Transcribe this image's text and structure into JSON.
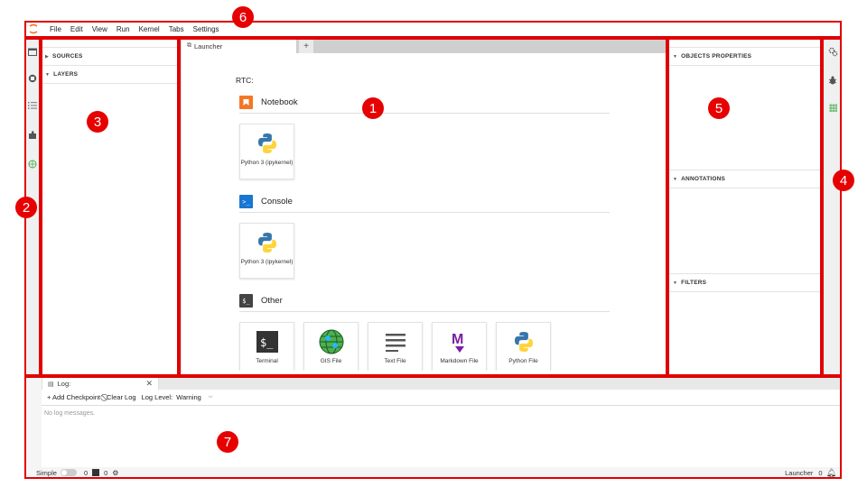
{
  "menubar": {
    "items": [
      "File",
      "Edit",
      "View",
      "Run",
      "Kernel",
      "Tabs",
      "Settings"
    ]
  },
  "left_panel": {
    "sections": [
      "SOURCES",
      "LAYERS"
    ]
  },
  "launcher": {
    "tab_label": "Launcher",
    "add_tab": "+",
    "rtc_label": "RTC:",
    "sections": [
      {
        "label": "Notebook",
        "icon": "notebook-icon",
        "cards": [
          {
            "label": "Python 3 (ipykernel)",
            "icon": "python-icon"
          }
        ]
      },
      {
        "label": "Console",
        "icon": "console-icon",
        "cards": [
          {
            "label": "Python 3 (ipykernel)",
            "icon": "python-icon"
          }
        ]
      },
      {
        "label": "Other",
        "icon": "other-icon",
        "cards": [
          {
            "label": "Terminal",
            "icon": "terminal-icon"
          },
          {
            "label": "GIS File",
            "icon": "globe-icon"
          },
          {
            "label": "Text File",
            "icon": "text-file-icon"
          },
          {
            "label": "Markdown File",
            "icon": "markdown-icon"
          },
          {
            "label": "Python File",
            "icon": "python-icon"
          }
        ]
      }
    ]
  },
  "right_panel": {
    "sections": [
      "OBJECTS PROPERTIES",
      "ANNOTATIONS",
      "FILTERS"
    ]
  },
  "log": {
    "tab_label": "Log:",
    "add_checkpoint": "+ Add Checkpoint",
    "clear_log": "Clear Log",
    "log_level_label": "Log Level:",
    "log_level_value": "Warning",
    "empty_message": "No log messages."
  },
  "statusbar": {
    "mode": "Simple",
    "terminals_count": "0",
    "kernels_count": "0",
    "current": "Launcher",
    "notifications": "0"
  },
  "annotations": [
    "1",
    "2",
    "3",
    "4",
    "5",
    "6",
    "7"
  ],
  "colors": {
    "annotation_red": "#e00000",
    "notebook_orange": "#f37726",
    "console_blue": "#1976d2",
    "markdown_purple": "#7b1fa2",
    "gis_green": "#4caf50"
  }
}
